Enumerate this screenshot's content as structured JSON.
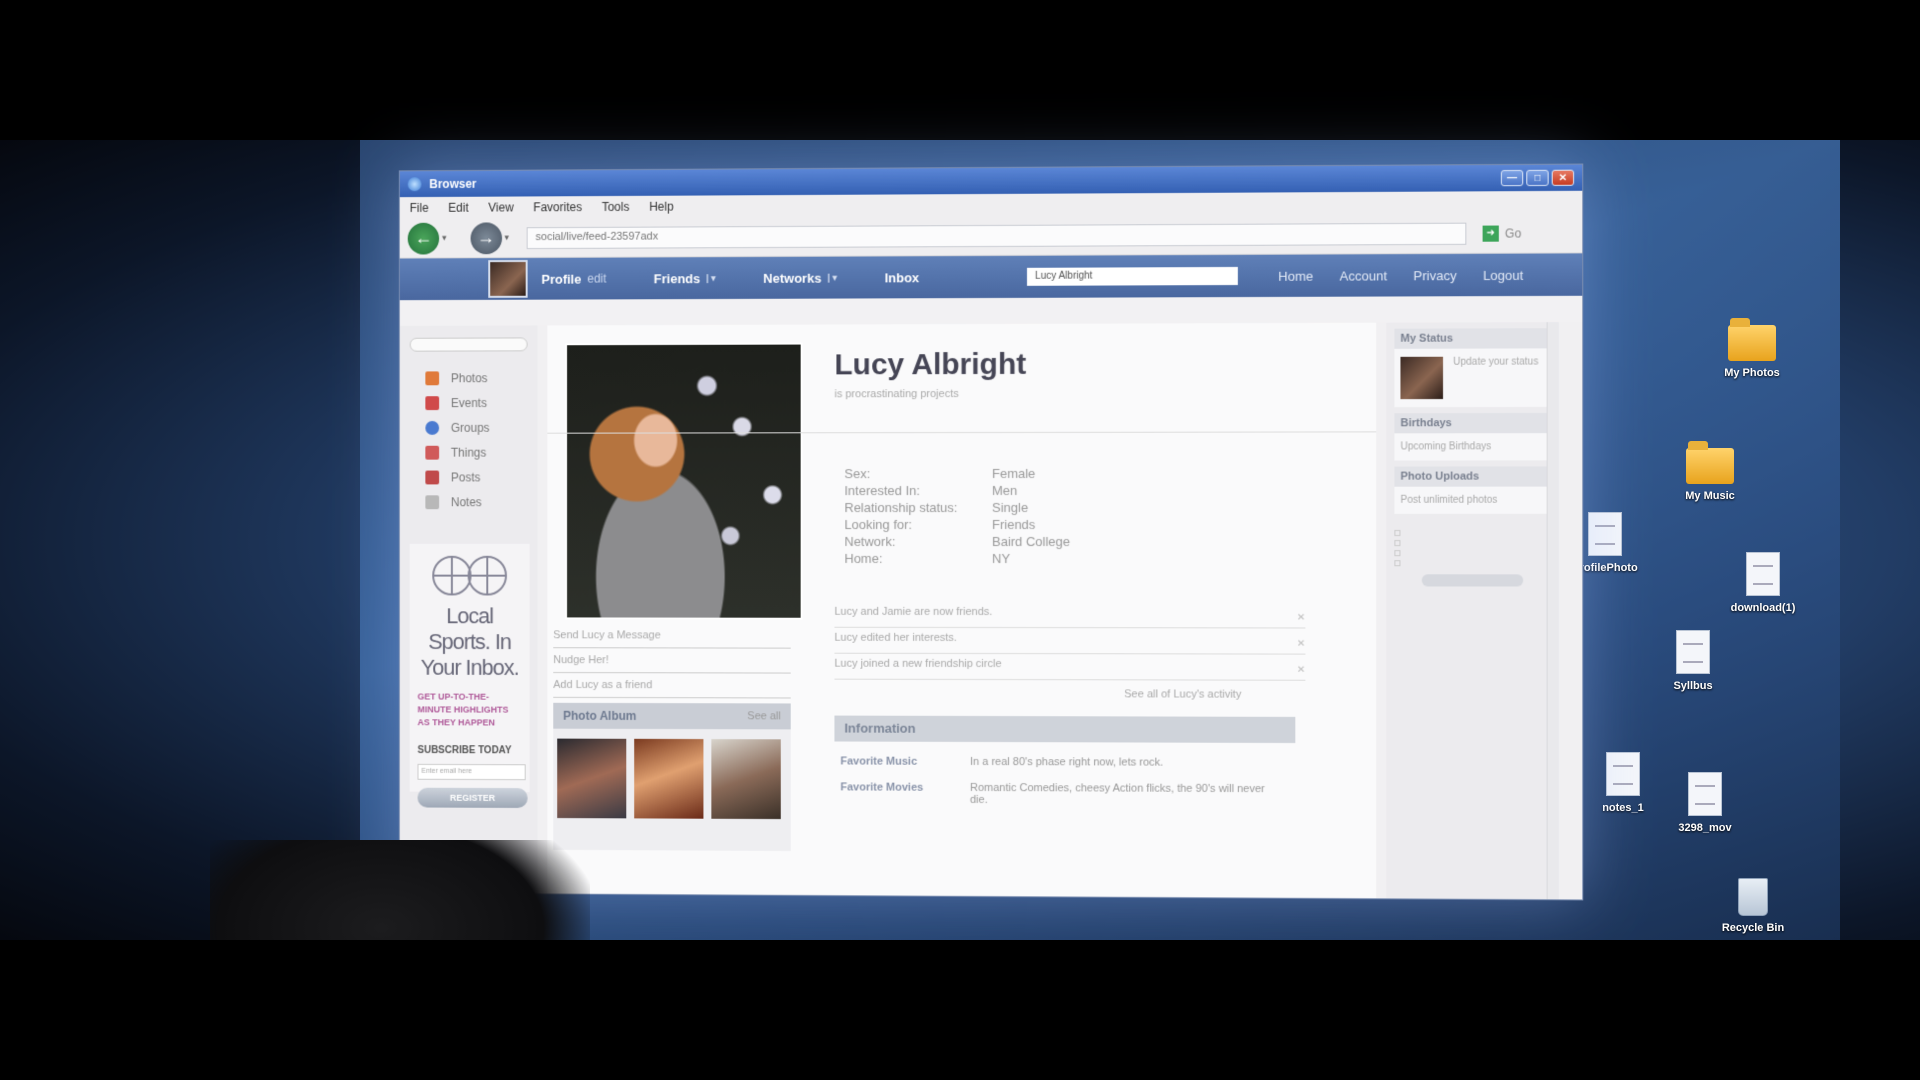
{
  "window": {
    "title": "Browser"
  },
  "menu": [
    "File",
    "Edit",
    "View",
    "Favorites",
    "Tools",
    "Help"
  ],
  "address": {
    "url": "social/live/feed-23597adx",
    "go_label": "Go"
  },
  "site_nav": {
    "profile_label": "Profile",
    "profile_edit": "edit",
    "friends_label": "Friends",
    "networks_label": "Networks",
    "inbox_label": "Inbox",
    "search_value": "Lucy Albright",
    "home_label": "Home",
    "account_label": "Account",
    "privacy_label": "Privacy",
    "logout_label": "Logout"
  },
  "sidebar": {
    "items": [
      {
        "label": "Photos",
        "icon": "photos-icon",
        "color": "#e07a3a"
      },
      {
        "label": "Events",
        "icon": "events-icon",
        "color": "#d04a4a"
      },
      {
        "label": "Groups",
        "icon": "groups-icon",
        "color": "#4a7ad0"
      },
      {
        "label": "Things",
        "icon": "things-icon",
        "color": "#d05a5a"
      },
      {
        "label": "Posts",
        "icon": "posts-icon",
        "color": "#c04a4a"
      },
      {
        "label": "Notes",
        "icon": "notes-icon",
        "color": "#b8b8b8"
      }
    ]
  },
  "ad": {
    "title": "Local Sports. In Your Inbox.",
    "subtitle": "GET UP-TO-THE-MINUTE HIGHLIGHTS AS THEY HAPPEN",
    "cta": "SUBSCRIBE TODAY",
    "input_placeholder": "Enter email here",
    "button": "REGISTER"
  },
  "profile": {
    "name": "Lucy Albright",
    "status": "is procrastinating projects",
    "details": [
      {
        "key": "Sex:",
        "value": "Female"
      },
      {
        "key": "Interested In:",
        "value": "Men"
      },
      {
        "key": "Relationship status:",
        "value": "Single"
      },
      {
        "key": "Looking for:",
        "value": "Friends"
      },
      {
        "key": "Network:",
        "value": "Baird College"
      },
      {
        "key": "Home:",
        "value": "NY"
      }
    ],
    "actions": [
      "Send Lucy a Message",
      "Nudge Her!",
      "Add Lucy as a friend"
    ]
  },
  "album": {
    "title": "Photo Album",
    "see_all": "See all"
  },
  "feed": {
    "items": [
      "Lucy and Jamie are now friends.",
      "Lucy edited her interests.",
      "Lucy joined a new friendship circle"
    ],
    "see_all": "See all of Lucy's activity"
  },
  "information": {
    "title": "Information",
    "rows": [
      {
        "key": "Favorite Music",
        "value": "In a real 80's phase right now, lets rock."
      },
      {
        "key": "Favorite Movies",
        "value": "Romantic Comedies, cheesy Action flicks, the 90's will never die."
      }
    ]
  },
  "right": {
    "status_title": "My Status",
    "status_text": "Update your status",
    "birthdays_title": "Birthdays",
    "birthdays_text": "Upcoming Birthdays",
    "uploads_title": "Photo Uploads",
    "uploads_text": "Post unlimited photos"
  },
  "desktop_icons": [
    {
      "label": "My Photos",
      "type": "folder"
    },
    {
      "label": "My Music",
      "type": "folder"
    },
    {
      "label": "ProfilePhoto",
      "type": "file"
    },
    {
      "label": "download(1)",
      "type": "file"
    },
    {
      "label": "Syllbus",
      "type": "file"
    },
    {
      "label": "notes_1",
      "type": "file"
    },
    {
      "label": "3298_mov",
      "type": "file"
    },
    {
      "label": "Recycle Bin",
      "type": "bin"
    }
  ]
}
